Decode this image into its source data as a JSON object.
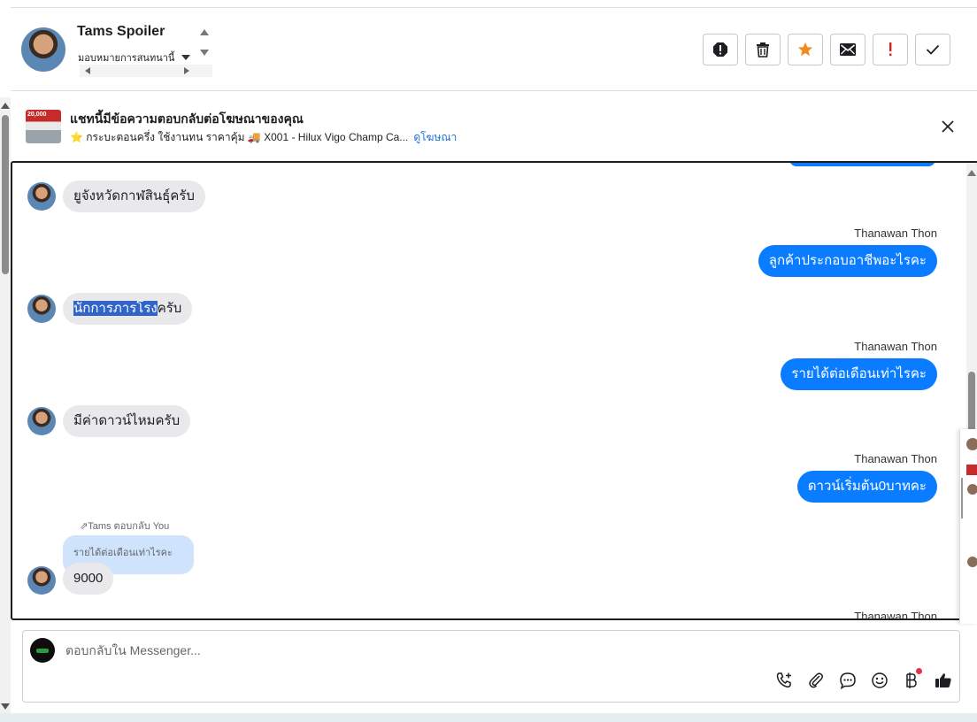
{
  "header": {
    "contact_name": "Tams Spoiler",
    "assign_label": "มอบหมายการสนทนานี้"
  },
  "actions": [
    {
      "name": "spam-button",
      "icon": "alert-octagon-icon"
    },
    {
      "name": "delete-button",
      "icon": "trash-icon"
    },
    {
      "name": "star-button",
      "icon": "star-icon"
    },
    {
      "name": "mark-unread-button",
      "icon": "envelope-icon"
    },
    {
      "name": "follow-up-button",
      "icon": "exclamation-icon"
    },
    {
      "name": "done-button",
      "icon": "check-icon"
    }
  ],
  "banner": {
    "thumb_price": "20,000",
    "title": "แชทนี้มีข้อความตอบกลับต่อโฆษณาของคุณ",
    "ad_text": "⭐ กระบะตอนครึ่ง ใช้งานทน ราคาคุ้ม 🚚 X001 - Hilux Vigo Champ Ca...",
    "link": "ดูโฆษณา"
  },
  "messages": {
    "m1_in": "ยูจังหวัดกาฬสินธุ์ครับ",
    "m2_sender": "Thanawan Thon",
    "m2_out": "ลูกค้าประกอบอาชีพอะไรคะ",
    "m3_in_selected": "นักการภารโรง",
    "m3_in_rest": "ครับ",
    "m4_sender": "Thanawan Thon",
    "m4_out": "รายได้ต่อเดือนเท่าไรคะ",
    "m5_in": "มีค่าดาวน์ไหมครับ",
    "m6_sender": "Thanawan Thon",
    "m6_out": "ดาวน์เริ่มต้น0บาทคะ",
    "reply_meta": "Tams ตอบกลับ You",
    "quoted_text": "รายได้ต่อเดือนเท่าไรคะ",
    "m7_in": "9000",
    "m8_sender": "Thanawan Thon"
  },
  "composer": {
    "placeholder": "ตอบกลับใน Messenger..."
  },
  "colors": {
    "outgoing": "#0a7cff",
    "incoming": "#e9e9eb",
    "link": "#216fdb",
    "star": "#f28b1e",
    "alert": "#e02020"
  }
}
